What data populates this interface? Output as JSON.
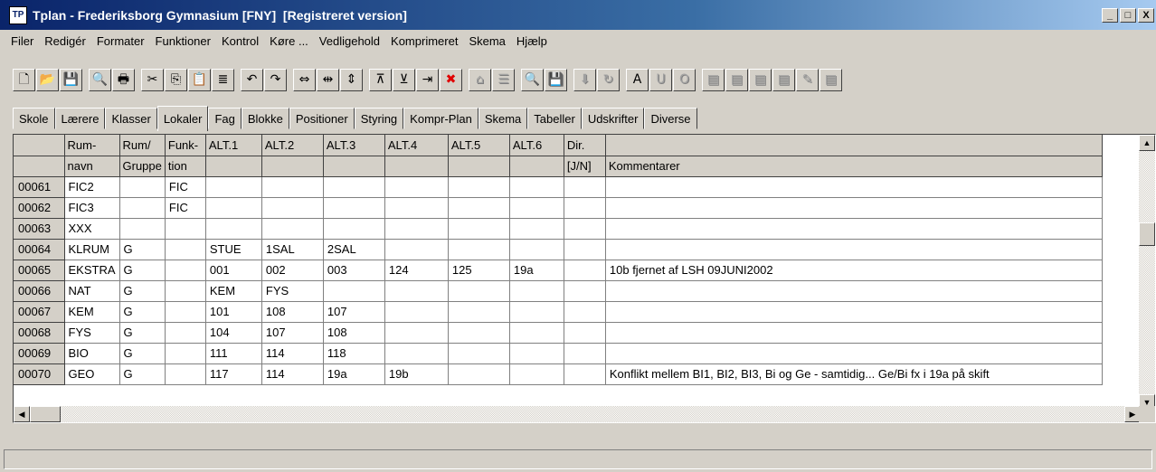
{
  "window": {
    "title": "Tplan - Frederiksborg Gymnasium [FNY]  [Registreret version]",
    "icon_label": "TP",
    "controls": [
      "_",
      "□",
      "X"
    ]
  },
  "menu": [
    "Filer",
    "Redigér",
    "Formater",
    "Funktioner",
    "Kontrol",
    "Køre ...",
    "Vedligehold",
    "Komprimeret",
    "Skema",
    "Hjælp"
  ],
  "toolbar": [
    {
      "name": "new-icon",
      "glyph": "🗋",
      "enabled": true
    },
    {
      "name": "open-folder-icon",
      "glyph": "📂",
      "enabled": true
    },
    {
      "name": "save-icon",
      "glyph": "💾",
      "enabled": true
    },
    {
      "name": "search-icon",
      "glyph": "🔍",
      "enabled": true
    },
    {
      "name": "print-icon",
      "glyph": "🖶",
      "enabled": true
    },
    {
      "name": "cut-icon",
      "glyph": "✂",
      "enabled": true
    },
    {
      "name": "copy-icon",
      "glyph": "⎘",
      "enabled": true
    },
    {
      "name": "paste-icon",
      "glyph": "📋",
      "enabled": true
    },
    {
      "name": "align-icon",
      "glyph": "≣",
      "enabled": true
    },
    {
      "name": "undo-icon",
      "glyph": "↶",
      "enabled": true
    },
    {
      "name": "redo-icon",
      "glyph": "↷",
      "enabled": true
    },
    {
      "name": "expand-horizontal-icon",
      "glyph": "⇔",
      "enabled": true
    },
    {
      "name": "shrink-horizontal-icon",
      "glyph": "⇹",
      "enabled": true
    },
    {
      "name": "expand-vertical-icon",
      "glyph": "⇕",
      "enabled": true
    },
    {
      "name": "insert-row-icon",
      "glyph": "⊼",
      "enabled": true
    },
    {
      "name": "insert-column-icon",
      "glyph": "⊻",
      "enabled": true
    },
    {
      "name": "move-right-icon",
      "glyph": "⇥",
      "enabled": true
    },
    {
      "name": "delete-icon",
      "glyph": "✖",
      "enabled": true,
      "color": "#e00000"
    },
    {
      "name": "home-icon",
      "glyph": "⌂",
      "enabled": false
    },
    {
      "name": "list-icon",
      "glyph": "☰",
      "enabled": false
    },
    {
      "name": "zoom-icon",
      "glyph": "🔍",
      "enabled": true
    },
    {
      "name": "save-disk-icon",
      "glyph": "💾",
      "enabled": false
    },
    {
      "name": "download-icon",
      "glyph": "⬇",
      "enabled": false
    },
    {
      "name": "refresh-icon",
      "glyph": "↻",
      "enabled": false
    },
    {
      "name": "letter-a-icon",
      "glyph": "A",
      "enabled": true
    },
    {
      "name": "letter-u-icon",
      "glyph": "U",
      "enabled": false
    },
    {
      "name": "letter-o-icon",
      "glyph": "O",
      "enabled": false
    },
    {
      "name": "block-e1-icon",
      "glyph": "▤",
      "enabled": false
    },
    {
      "name": "block-e2-icon",
      "glyph": "▤",
      "enabled": false
    },
    {
      "name": "block-add1-icon",
      "glyph": "▤",
      "enabled": false
    },
    {
      "name": "block-add2-icon",
      "glyph": "▤",
      "enabled": false
    },
    {
      "name": "block-pen-icon",
      "glyph": "✎",
      "enabled": false
    },
    {
      "name": "block-arrow-icon",
      "glyph": "▤",
      "enabled": false
    }
  ],
  "tabs": [
    "Skole",
    "Lærere",
    "Klasser",
    "Lokaler",
    "Fag",
    "Blokke",
    "Positioner",
    "Styring",
    "Kompr-Plan",
    "Skema",
    "Tabeller",
    "Udskrifter",
    "Diverse"
  ],
  "active_tab": "Lokaler",
  "grid": {
    "header_row1": [
      "",
      "Rum-",
      "Rum/",
      "Funk-",
      "ALT.1",
      "ALT.2",
      "ALT.3",
      "ALT.4",
      "ALT.5",
      "ALT.6",
      "Dir.",
      ""
    ],
    "header_row2": [
      "",
      "navn",
      "Gruppe",
      "tion",
      "",
      "",
      "",
      "",
      "",
      "",
      "[J/N]",
      "Kommentarer"
    ],
    "rows": [
      [
        "00061",
        "FIC2",
        "",
        "FIC",
        "",
        "",
        "",
        "",
        "",
        "",
        "",
        ""
      ],
      [
        "00062",
        "FIC3",
        "",
        "FIC",
        "",
        "",
        "",
        "",
        "",
        "",
        "",
        ""
      ],
      [
        "00063",
        "XXX",
        "",
        "",
        "",
        "",
        "",
        "",
        "",
        "",
        "",
        ""
      ],
      [
        "00064",
        "KLRUM",
        "G",
        "",
        "STUE",
        "1SAL",
        "2SAL",
        "",
        "",
        "",
        "",
        ""
      ],
      [
        "00065",
        "EKSTRA",
        "G",
        "",
        "001",
        "002",
        "003",
        "124",
        "125",
        "19a",
        "",
        "10b fjernet af LSH 09JUNI2002"
      ],
      [
        "00066",
        "NAT",
        "G",
        "",
        "KEM",
        "FYS",
        "",
        "",
        "",
        "",
        "",
        ""
      ],
      [
        "00067",
        "KEM",
        "G",
        "",
        "101",
        "108",
        "107",
        "",
        "",
        "",
        "",
        ""
      ],
      [
        "00068",
        "FYS",
        "G",
        "",
        "104",
        "107",
        "108",
        "",
        "",
        "",
        "",
        ""
      ],
      [
        "00069",
        "BIO",
        "G",
        "",
        "111",
        "114",
        "118",
        "",
        "",
        "",
        "",
        ""
      ],
      [
        "00070",
        "GEO",
        "G",
        "",
        "117",
        "114",
        "19a",
        "19b",
        "",
        "",
        "",
        "Konflikt mellem BI1, BI2, BI3, Bi og Ge - samtidig... Ge/Bi  fx i 19a på skift"
      ]
    ]
  },
  "status": ""
}
